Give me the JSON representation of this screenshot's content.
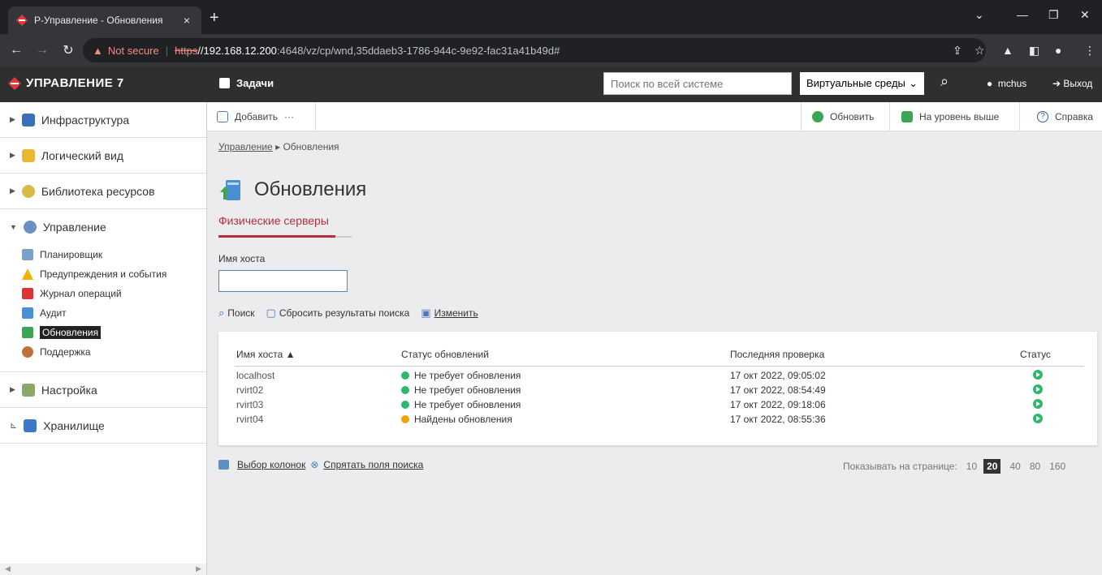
{
  "browser": {
    "tab_title": "Р-Управление - Обновления",
    "tab_close": "×",
    "new_tab": "+",
    "url_warning": "Not secure",
    "url_scheme": "https",
    "url_host": "//192.168.12.200",
    "url_rest": ":4648/vz/cp/wnd,35ddaeb3-1786-944c-9e92-fac31a41b49d#"
  },
  "app": {
    "logo": "УПРАВЛЕНИЕ 7",
    "tasks": "Задачи",
    "search_placeholder": "Поиск по всей системе",
    "scope": "Виртуальные среды",
    "user": "mchus",
    "logout": "Выход"
  },
  "sidebar": {
    "infra": "Инфраструктура",
    "logical": "Логический вид",
    "library": "Библиотека ресурсов",
    "mgmt": "Управление",
    "mgmt_items": [
      "Планировщик",
      "Предупреждения и события",
      "Журнал операций",
      "Аудит",
      "Обновления",
      "Поддержка"
    ],
    "settings": "Настройка",
    "storage": "Хранилище"
  },
  "toolbar": {
    "add": "Добавить",
    "more": "···",
    "refresh": "Обновить",
    "up": "На уровень выше",
    "help": "Справка"
  },
  "content": {
    "crumb_root": "Управление",
    "crumb_sep": "▸",
    "crumb_current": "Обновления",
    "title": "Обновления",
    "subtab": "Физические серверы",
    "host_label": "Имя хоста",
    "host_value": "",
    "search": "Поиск",
    "reset": "Сбросить результаты поиска",
    "edit": "Изменить"
  },
  "table": {
    "columns": [
      "Имя хоста ▲",
      "Статус обновлений",
      "Последняя проверка",
      "Статус"
    ],
    "rows": [
      {
        "host": "localhost",
        "status": "Не требует обновления",
        "checked": "17 окт 2022, 09:05:02"
      },
      {
        "host": "rvirt02",
        "status": "Не требует обновления",
        "checked": "17 окт 2022, 08:54:49"
      },
      {
        "host": "rvirt03",
        "status": "Не требует обновления",
        "checked": "17 окт 2022, 09:18:06"
      },
      {
        "host": "rvirt04",
        "status": "Найдены обновления",
        "checked": "17 окт 2022, 08:55:36"
      }
    ]
  },
  "footer": {
    "columns": "Выбор колонок",
    "hide": "Спрятать поля поиска",
    "per_page": "Показывать на странице:",
    "pages": [
      "10",
      "20",
      "40",
      "80",
      "160"
    ]
  },
  "colors": {
    "accent": "#b5303e",
    "ok": "#2eb86c",
    "warn": "#f0a30a"
  }
}
